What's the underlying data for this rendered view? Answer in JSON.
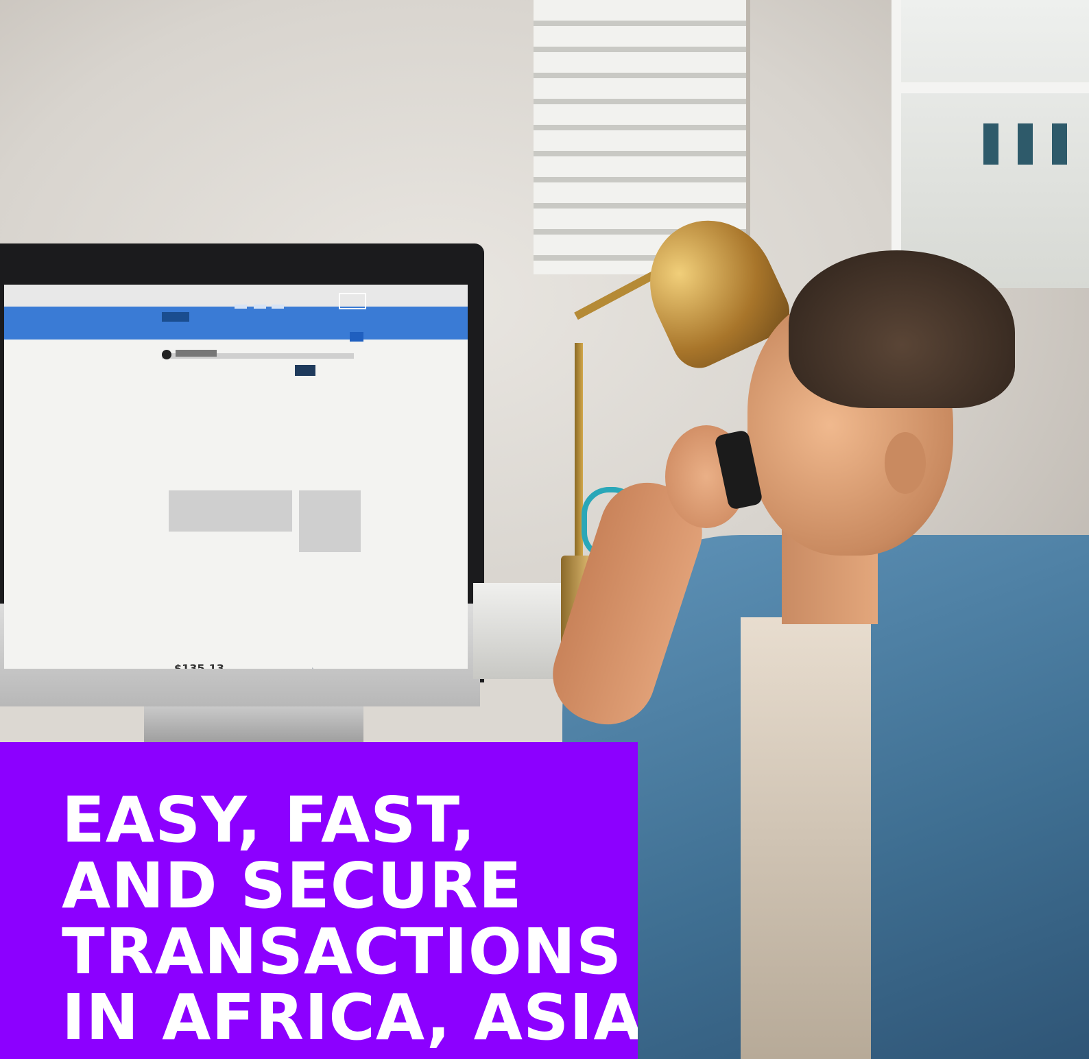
{
  "headline": {
    "lines": [
      "EASY, FAST,",
      "AND SECURE",
      "TRANSACTIONS",
      "IN AFRICA, ASIA,"
    ]
  },
  "screen": {
    "price": "$135.13"
  },
  "colors": {
    "panel": "#8c00ff",
    "text": "#ffffff",
    "site_header": "#3a7bd5"
  },
  "icons": [
    "apple-logo-icon",
    "ethereum-icon"
  ]
}
